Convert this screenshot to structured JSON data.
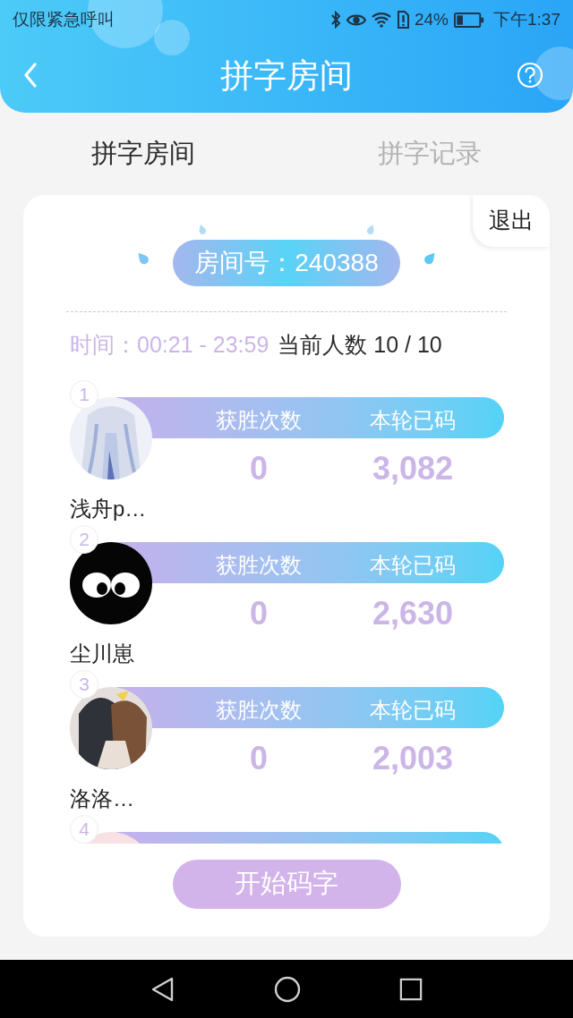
{
  "status_bar": {
    "carrier": "仅限紧急呼叫",
    "battery": "24%",
    "time": "下午1:37"
  },
  "header": {
    "title": "拼字房间"
  },
  "tabs": [
    {
      "label": "拼字房间",
      "selected": true
    },
    {
      "label": "拼字记录",
      "selected": false
    }
  ],
  "room": {
    "exit": "退出",
    "room_number": "房间号：240388",
    "time_label": "时间：00:21 - 23:59",
    "players_label": "当前人数 10 / 10"
  },
  "players": [
    {
      "rank": "1",
      "wins_label": "获胜次数",
      "typed_label": "本轮已码",
      "wins": "0",
      "typed": "3,082",
      "name": "浅舟p…"
    },
    {
      "rank": "2",
      "wins_label": "获胜次数",
      "typed_label": "本轮已码",
      "wins": "0",
      "typed": "2,630",
      "name": "尘川崽"
    },
    {
      "rank": "3",
      "wins_label": "获胜次数",
      "typed_label": "本轮已码",
      "wins": "0",
      "typed": "2,003",
      "name": "洛洛…"
    },
    {
      "rank": "4"
    }
  ],
  "start_button": "开始码字"
}
